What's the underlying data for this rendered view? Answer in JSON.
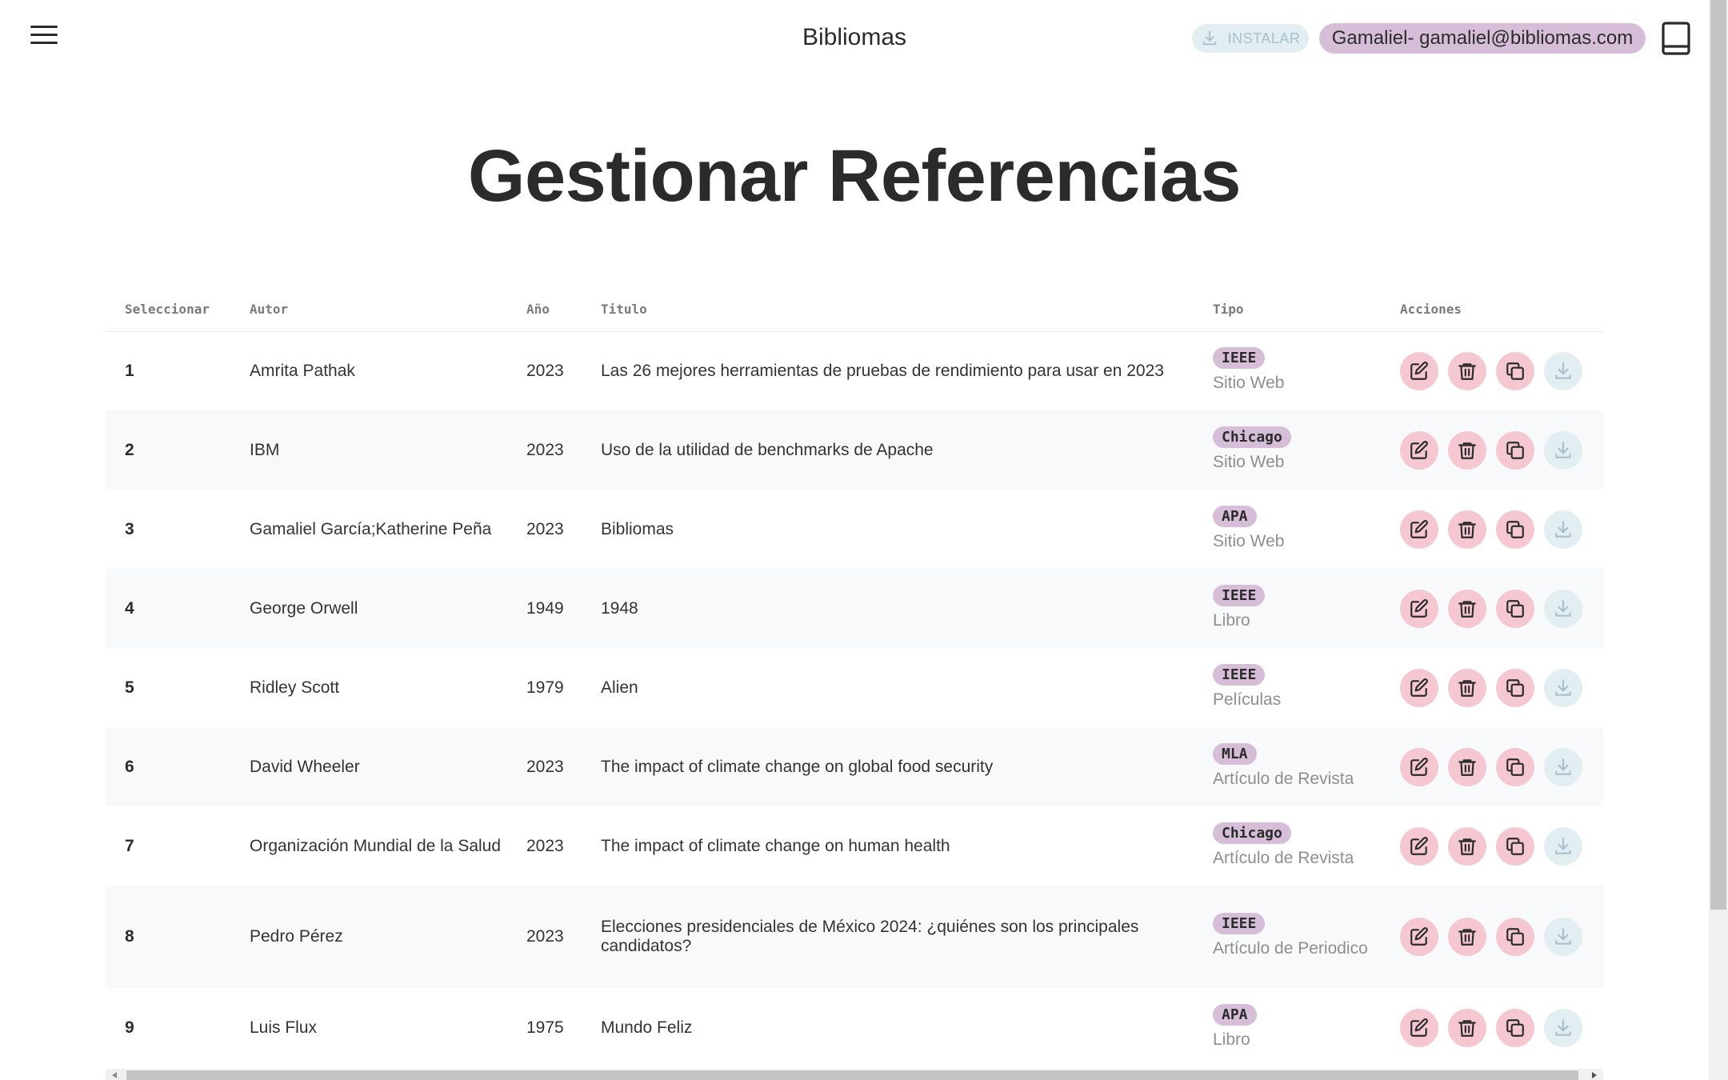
{
  "header": {
    "brand": "Bibliomas",
    "install_label": "INSTALAR",
    "user": "Gamaliel- gamaliel@bibliomas.com"
  },
  "page": {
    "title": "Gestionar Referencias"
  },
  "table": {
    "columns": {
      "select": "Seleccionar",
      "author": "Autor",
      "year": "Año",
      "title": "Titulo",
      "type": "Tipo",
      "actions": "Acciones"
    },
    "rows": [
      {
        "n": "1",
        "author": "Amrita Pathak",
        "year": "2023",
        "title": "Las 26 mejores herramientas de pruebas de rendimiento para usar en 2023",
        "style": "IEEE",
        "kind": "Sitio Web"
      },
      {
        "n": "2",
        "author": "IBM",
        "year": "2023",
        "title": "Uso de la utilidad de benchmarks de Apache",
        "style": "Chicago",
        "kind": "Sitio Web"
      },
      {
        "n": "3",
        "author": "Gamaliel García;Katherine Peña",
        "year": "2023",
        "title": "Bibliomas",
        "style": "APA",
        "kind": "Sitio Web"
      },
      {
        "n": "4",
        "author": "George Orwell",
        "year": "1949",
        "title": "1948",
        "style": "IEEE",
        "kind": "Libro"
      },
      {
        "n": "5",
        "author": "Ridley Scott",
        "year": "1979",
        "title": "Alien",
        "style": "IEEE",
        "kind": "Películas"
      },
      {
        "n": "6",
        "author": "David Wheeler",
        "year": "2023",
        "title": "The impact of climate change on global food security",
        "style": "MLA",
        "kind": "Artículo de Revista"
      },
      {
        "n": "7",
        "author": "Organización Mundial de la Salud",
        "year": "2023",
        "title": "The impact of climate change on human health",
        "style": "Chicago",
        "kind": "Artículo de Revista"
      },
      {
        "n": "8",
        "author": "Pedro Pérez",
        "year": "2023",
        "title": "Elecciones presidenciales de México 2024: ¿quiénes son los principales candidatos?",
        "style": "IEEE",
        "kind": "Artículo de Periodico"
      },
      {
        "n": "9",
        "author": "Luis Flux",
        "year": "1975",
        "title": "Mundo Feliz",
        "style": "APA",
        "kind": "Libro"
      }
    ]
  },
  "icons": {
    "menu": "hamburger-menu-icon",
    "install": "download-icon",
    "book": "book-icon",
    "edit": "edit-pencil-icon",
    "delete": "trash-icon",
    "duplicate": "copy-icon",
    "download": "download-icon"
  },
  "colors": {
    "accent_chip": "#d6bed8",
    "action_button": "#f4c7d1",
    "disabled_button": "#e3eef3"
  }
}
